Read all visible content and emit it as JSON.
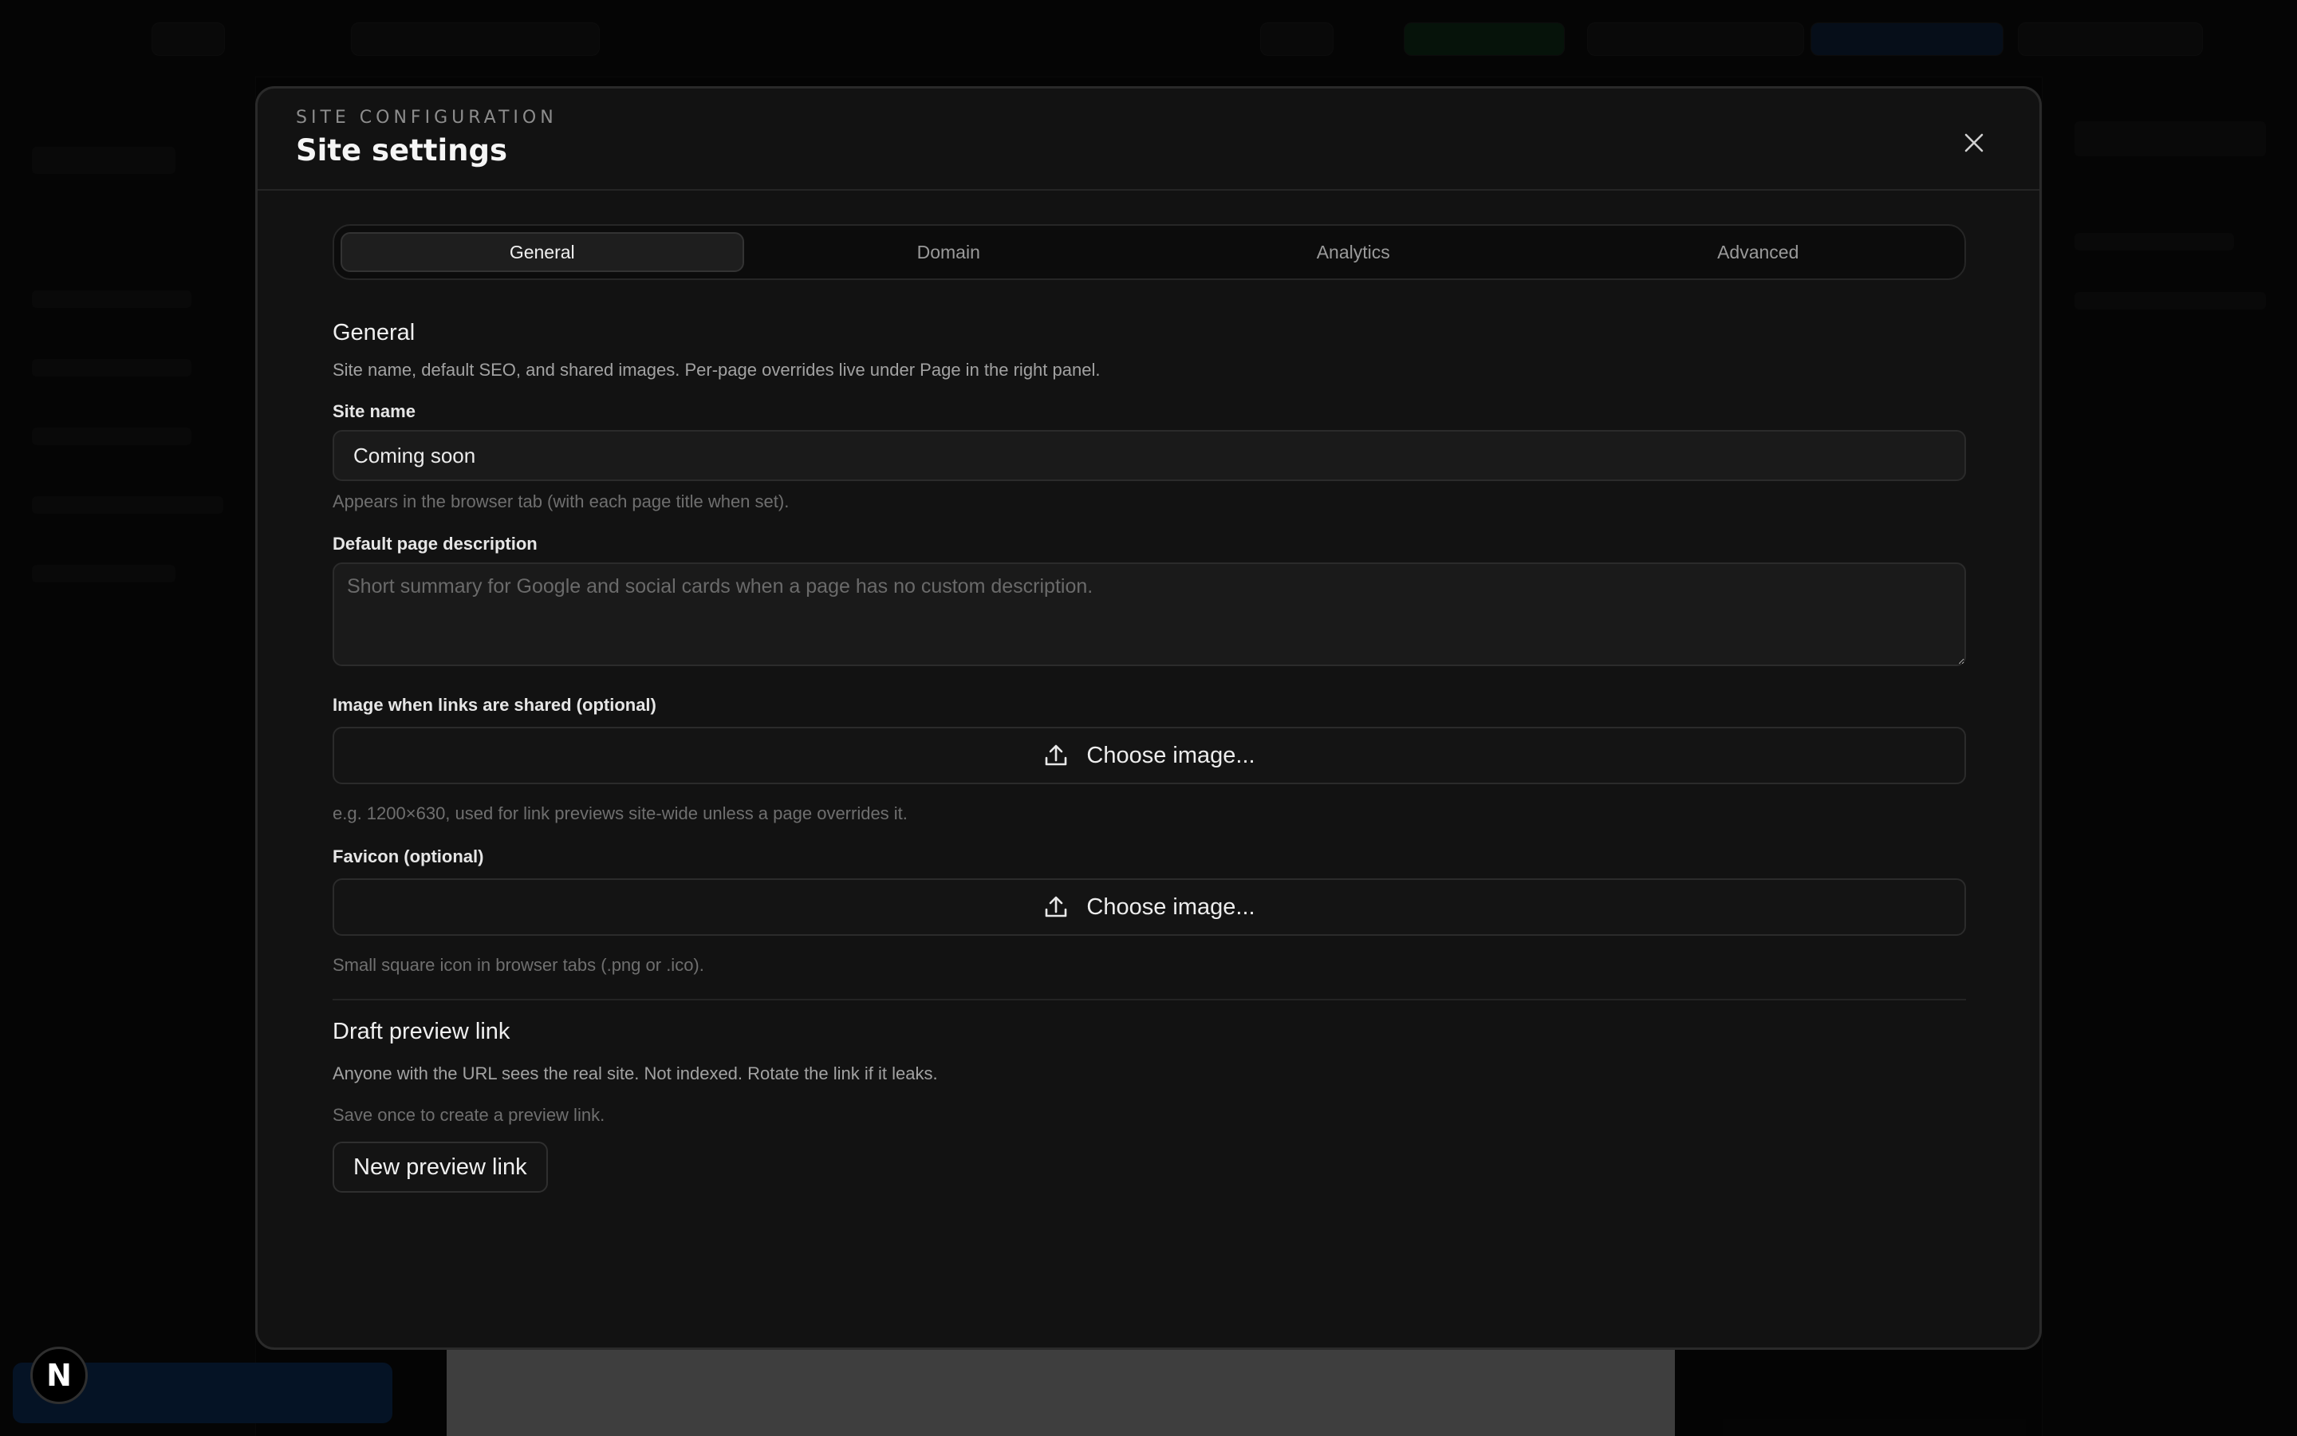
{
  "modal": {
    "eyebrow": "SITE CONFIGURATION",
    "title": "Site settings"
  },
  "tabs": [
    {
      "label": "General",
      "active": true
    },
    {
      "label": "Domain",
      "active": false
    },
    {
      "label": "Analytics",
      "active": false
    },
    {
      "label": "Advanced",
      "active": false
    }
  ],
  "general": {
    "title": "General",
    "description": "Site name, default SEO, and shared images. Per-page overrides live under Page in the right panel.",
    "site_name": {
      "label": "Site name",
      "value": "Coming soon",
      "hint": "Appears in the browser tab (with each page title when set)."
    },
    "page_description": {
      "label": "Default page description",
      "value": "",
      "placeholder": "Short summary for Google and social cards when a page has no custom description."
    },
    "share_image": {
      "label": "Image when links are shared (optional)",
      "button": "Choose image...",
      "hint": "e.g. 1200×630, used for link previews site-wide unless a page overrides it."
    },
    "favicon": {
      "label": "Favicon (optional)",
      "button": "Choose image...",
      "hint": "Small square icon in browser tabs (.png or .ico)."
    }
  },
  "draft_preview": {
    "title": "Draft preview link",
    "description": "Anyone with the URL sees the real site. Not indexed. Rotate the link if it leaks.",
    "hint": "Save once to create a preview link.",
    "button": "New preview link"
  },
  "badge": {
    "letter": "N"
  },
  "icons": {
    "close": "close-icon",
    "upload": "upload-icon"
  },
  "colors": {
    "modal_bg": "#121212",
    "overlay": "#050505",
    "tab_active_bg": "#1e1e1e"
  }
}
